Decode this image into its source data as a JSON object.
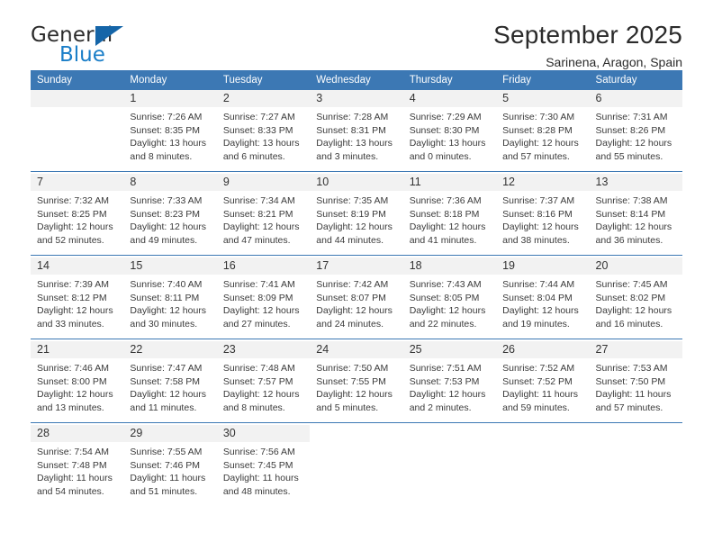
{
  "brand": {
    "name_part1": "General",
    "name_part2": "Blue",
    "triangle_color": "#1565a8",
    "blue_color": "#1a7ec8"
  },
  "header": {
    "title": "September 2025",
    "subtitle": "Sarinena, Aragon, Spain"
  },
  "theme": {
    "header_row_bg": "#3c78b4",
    "daynum_bg": "#f2f2f2",
    "separator": "#3c78b4"
  },
  "weekdays": [
    "Sunday",
    "Monday",
    "Tuesday",
    "Wednesday",
    "Thursday",
    "Friday",
    "Saturday"
  ],
  "weeks": [
    [
      {
        "day": "",
        "sunrise": "",
        "sunset": "",
        "daylight1": "",
        "daylight2": "",
        "empty": true
      },
      {
        "day": "1",
        "sunrise": "Sunrise: 7:26 AM",
        "sunset": "Sunset: 8:35 PM",
        "daylight1": "Daylight: 13 hours",
        "daylight2": "and 8 minutes."
      },
      {
        "day": "2",
        "sunrise": "Sunrise: 7:27 AM",
        "sunset": "Sunset: 8:33 PM",
        "daylight1": "Daylight: 13 hours",
        "daylight2": "and 6 minutes."
      },
      {
        "day": "3",
        "sunrise": "Sunrise: 7:28 AM",
        "sunset": "Sunset: 8:31 PM",
        "daylight1": "Daylight: 13 hours",
        "daylight2": "and 3 minutes."
      },
      {
        "day": "4",
        "sunrise": "Sunrise: 7:29 AM",
        "sunset": "Sunset: 8:30 PM",
        "daylight1": "Daylight: 13 hours",
        "daylight2": "and 0 minutes."
      },
      {
        "day": "5",
        "sunrise": "Sunrise: 7:30 AM",
        "sunset": "Sunset: 8:28 PM",
        "daylight1": "Daylight: 12 hours",
        "daylight2": "and 57 minutes."
      },
      {
        "day": "6",
        "sunrise": "Sunrise: 7:31 AM",
        "sunset": "Sunset: 8:26 PM",
        "daylight1": "Daylight: 12 hours",
        "daylight2": "and 55 minutes."
      }
    ],
    [
      {
        "day": "7",
        "sunrise": "Sunrise: 7:32 AM",
        "sunset": "Sunset: 8:25 PM",
        "daylight1": "Daylight: 12 hours",
        "daylight2": "and 52 minutes."
      },
      {
        "day": "8",
        "sunrise": "Sunrise: 7:33 AM",
        "sunset": "Sunset: 8:23 PM",
        "daylight1": "Daylight: 12 hours",
        "daylight2": "and 49 minutes."
      },
      {
        "day": "9",
        "sunrise": "Sunrise: 7:34 AM",
        "sunset": "Sunset: 8:21 PM",
        "daylight1": "Daylight: 12 hours",
        "daylight2": "and 47 minutes."
      },
      {
        "day": "10",
        "sunrise": "Sunrise: 7:35 AM",
        "sunset": "Sunset: 8:19 PM",
        "daylight1": "Daylight: 12 hours",
        "daylight2": "and 44 minutes."
      },
      {
        "day": "11",
        "sunrise": "Sunrise: 7:36 AM",
        "sunset": "Sunset: 8:18 PM",
        "daylight1": "Daylight: 12 hours",
        "daylight2": "and 41 minutes."
      },
      {
        "day": "12",
        "sunrise": "Sunrise: 7:37 AM",
        "sunset": "Sunset: 8:16 PM",
        "daylight1": "Daylight: 12 hours",
        "daylight2": "and 38 minutes."
      },
      {
        "day": "13",
        "sunrise": "Sunrise: 7:38 AM",
        "sunset": "Sunset: 8:14 PM",
        "daylight1": "Daylight: 12 hours",
        "daylight2": "and 36 minutes."
      }
    ],
    [
      {
        "day": "14",
        "sunrise": "Sunrise: 7:39 AM",
        "sunset": "Sunset: 8:12 PM",
        "daylight1": "Daylight: 12 hours",
        "daylight2": "and 33 minutes."
      },
      {
        "day": "15",
        "sunrise": "Sunrise: 7:40 AM",
        "sunset": "Sunset: 8:11 PM",
        "daylight1": "Daylight: 12 hours",
        "daylight2": "and 30 minutes."
      },
      {
        "day": "16",
        "sunrise": "Sunrise: 7:41 AM",
        "sunset": "Sunset: 8:09 PM",
        "daylight1": "Daylight: 12 hours",
        "daylight2": "and 27 minutes."
      },
      {
        "day": "17",
        "sunrise": "Sunrise: 7:42 AM",
        "sunset": "Sunset: 8:07 PM",
        "daylight1": "Daylight: 12 hours",
        "daylight2": "and 24 minutes."
      },
      {
        "day": "18",
        "sunrise": "Sunrise: 7:43 AM",
        "sunset": "Sunset: 8:05 PM",
        "daylight1": "Daylight: 12 hours",
        "daylight2": "and 22 minutes."
      },
      {
        "day": "19",
        "sunrise": "Sunrise: 7:44 AM",
        "sunset": "Sunset: 8:04 PM",
        "daylight1": "Daylight: 12 hours",
        "daylight2": "and 19 minutes."
      },
      {
        "day": "20",
        "sunrise": "Sunrise: 7:45 AM",
        "sunset": "Sunset: 8:02 PM",
        "daylight1": "Daylight: 12 hours",
        "daylight2": "and 16 minutes."
      }
    ],
    [
      {
        "day": "21",
        "sunrise": "Sunrise: 7:46 AM",
        "sunset": "Sunset: 8:00 PM",
        "daylight1": "Daylight: 12 hours",
        "daylight2": "and 13 minutes."
      },
      {
        "day": "22",
        "sunrise": "Sunrise: 7:47 AM",
        "sunset": "Sunset: 7:58 PM",
        "daylight1": "Daylight: 12 hours",
        "daylight2": "and 11 minutes."
      },
      {
        "day": "23",
        "sunrise": "Sunrise: 7:48 AM",
        "sunset": "Sunset: 7:57 PM",
        "daylight1": "Daylight: 12 hours",
        "daylight2": "and 8 minutes."
      },
      {
        "day": "24",
        "sunrise": "Sunrise: 7:50 AM",
        "sunset": "Sunset: 7:55 PM",
        "daylight1": "Daylight: 12 hours",
        "daylight2": "and 5 minutes."
      },
      {
        "day": "25",
        "sunrise": "Sunrise: 7:51 AM",
        "sunset": "Sunset: 7:53 PM",
        "daylight1": "Daylight: 12 hours",
        "daylight2": "and 2 minutes."
      },
      {
        "day": "26",
        "sunrise": "Sunrise: 7:52 AM",
        "sunset": "Sunset: 7:52 PM",
        "daylight1": "Daylight: 11 hours",
        "daylight2": "and 59 minutes."
      },
      {
        "day": "27",
        "sunrise": "Sunrise: 7:53 AM",
        "sunset": "Sunset: 7:50 PM",
        "daylight1": "Daylight: 11 hours",
        "daylight2": "and 57 minutes."
      }
    ],
    [
      {
        "day": "28",
        "sunrise": "Sunrise: 7:54 AM",
        "sunset": "Sunset: 7:48 PM",
        "daylight1": "Daylight: 11 hours",
        "daylight2": "and 54 minutes."
      },
      {
        "day": "29",
        "sunrise": "Sunrise: 7:55 AM",
        "sunset": "Sunset: 7:46 PM",
        "daylight1": "Daylight: 11 hours",
        "daylight2": "and 51 minutes."
      },
      {
        "day": "30",
        "sunrise": "Sunrise: 7:56 AM",
        "sunset": "Sunset: 7:45 PM",
        "daylight1": "Daylight: 11 hours",
        "daylight2": "and 48 minutes."
      },
      {
        "day": "",
        "sunrise": "",
        "sunset": "",
        "daylight1": "",
        "daylight2": "",
        "blank": true
      },
      {
        "day": "",
        "sunrise": "",
        "sunset": "",
        "daylight1": "",
        "daylight2": "",
        "blank": true
      },
      {
        "day": "",
        "sunrise": "",
        "sunset": "",
        "daylight1": "",
        "daylight2": "",
        "blank": true
      },
      {
        "day": "",
        "sunrise": "",
        "sunset": "",
        "daylight1": "",
        "daylight2": "",
        "blank": true
      }
    ]
  ]
}
